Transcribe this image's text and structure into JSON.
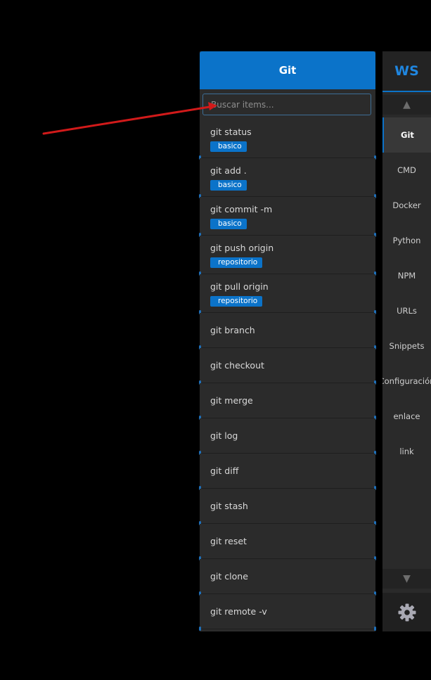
{
  "panel": {
    "title": "Git",
    "search": {
      "placeholder": "Buscar items...",
      "value": ""
    },
    "items": [
      {
        "label": "git status",
        "tag": "basico"
      },
      {
        "label": "git add .",
        "tag": "basico"
      },
      {
        "label": "git commit -m",
        "tag": "basico"
      },
      {
        "label": "git push origin",
        "tag": "repositorio"
      },
      {
        "label": "git pull origin",
        "tag": "repositorio"
      },
      {
        "label": "git branch"
      },
      {
        "label": "git checkout"
      },
      {
        "label": "git merge"
      },
      {
        "label": "git log"
      },
      {
        "label": "git diff"
      },
      {
        "label": "git stash"
      },
      {
        "label": "git reset"
      },
      {
        "label": "git clone"
      },
      {
        "label": "git remote -v"
      }
    ]
  },
  "sidebar": {
    "logo": "WS",
    "scroll_up_icon": "triangle-up-icon",
    "scroll_down_icon": "triangle-down-icon",
    "settings_icon": "gear-icon",
    "active": "Git",
    "items": [
      "Git",
      "CMD",
      "Docker",
      "Python",
      "NPM",
      "URLs",
      "Snippets",
      "Configuración",
      "enlace",
      "link"
    ]
  },
  "annotation": {
    "type": "red-arrow",
    "color": "#d11a1a"
  },
  "colors": {
    "accent": "#0b73c9",
    "panel_bg": "#2b2b2b",
    "page_bg": "#000000"
  }
}
